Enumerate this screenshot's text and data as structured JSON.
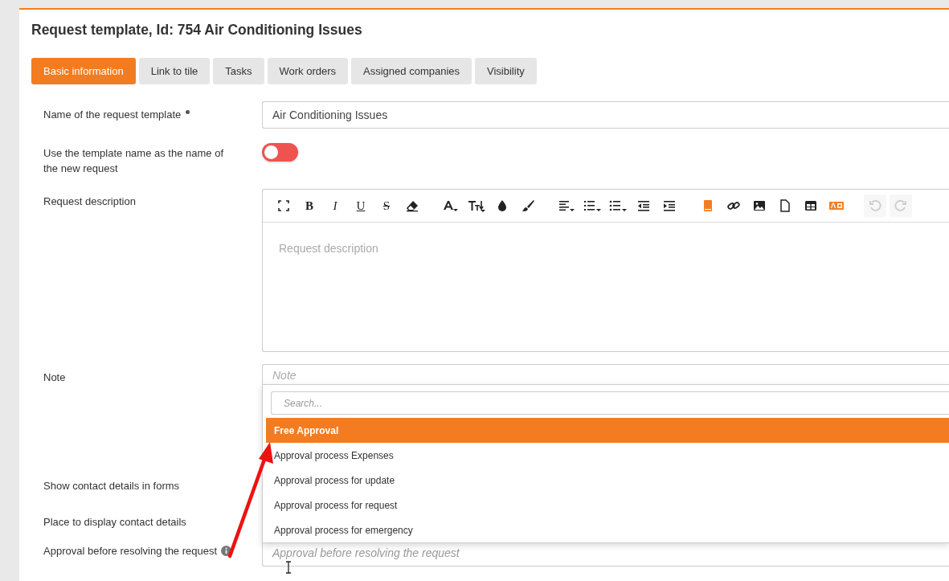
{
  "page_title": "Request template, Id: 754 Air Conditioning Issues",
  "tabs": [
    {
      "label": "Basic information",
      "selected": true
    },
    {
      "label": "Link to tile",
      "selected": false
    },
    {
      "label": "Tasks",
      "selected": false
    },
    {
      "label": "Work orders",
      "selected": false
    },
    {
      "label": "Assigned companies",
      "selected": false
    },
    {
      "label": "Visibility",
      "selected": false
    }
  ],
  "fields": [
    {
      "kind": "text",
      "label": "Name of the request template",
      "required": true,
      "value": "Air Conditioning Issues"
    },
    {
      "kind": "toggle",
      "label": "Use the template name as the name of the new request",
      "on": false
    },
    {
      "kind": "editor",
      "label": "Request description",
      "placeholder": "Request description",
      "toolbar_groups": [
        [
          {
            "kind": "fullscreen"
          },
          {
            "kind": "bold",
            "glyph": "B"
          },
          {
            "kind": "italic",
            "glyph": "I"
          },
          {
            "kind": "underline",
            "glyph": "U"
          },
          {
            "kind": "strike",
            "glyph": "S"
          },
          {
            "kind": "eraser"
          }
        ],
        [
          {
            "kind": "font-color"
          },
          {
            "kind": "font-size"
          },
          {
            "kind": "drop"
          },
          {
            "kind": "brush"
          }
        ],
        [
          {
            "kind": "align"
          },
          {
            "kind": "ordered-list"
          },
          {
            "kind": "bullet-list"
          },
          {
            "kind": "outdent"
          },
          {
            "kind": "indent"
          }
        ],
        [
          {
            "kind": "book"
          },
          {
            "kind": "link"
          },
          {
            "kind": "image"
          },
          {
            "kind": "file"
          },
          {
            "kind": "table"
          },
          {
            "kind": "badge"
          }
        ],
        [
          {
            "kind": "undo",
            "disabled": true
          },
          {
            "kind": "redo",
            "disabled": true
          }
        ]
      ]
    },
    {
      "kind": "note",
      "label": "Note",
      "placeholder": "Note"
    },
    {
      "kind": "hidden",
      "label": "Show contact details in forms"
    },
    {
      "kind": "hidden",
      "label": "Place to display contact details"
    },
    {
      "kind": "select",
      "label": "Approval before resolving the request",
      "info": true,
      "placeholder": "Approval before resolving the request"
    }
  ],
  "dropdown": {
    "search_placeholder": "Search...",
    "options": [
      {
        "label": "Free Approval",
        "selected": true
      },
      {
        "label": "Approval process Expenses",
        "selected": false
      },
      {
        "label": "Approval process for update",
        "selected": false
      },
      {
        "label": "Approval process for request",
        "selected": false
      },
      {
        "label": "Approval process for emergency",
        "selected": false
      }
    ]
  }
}
